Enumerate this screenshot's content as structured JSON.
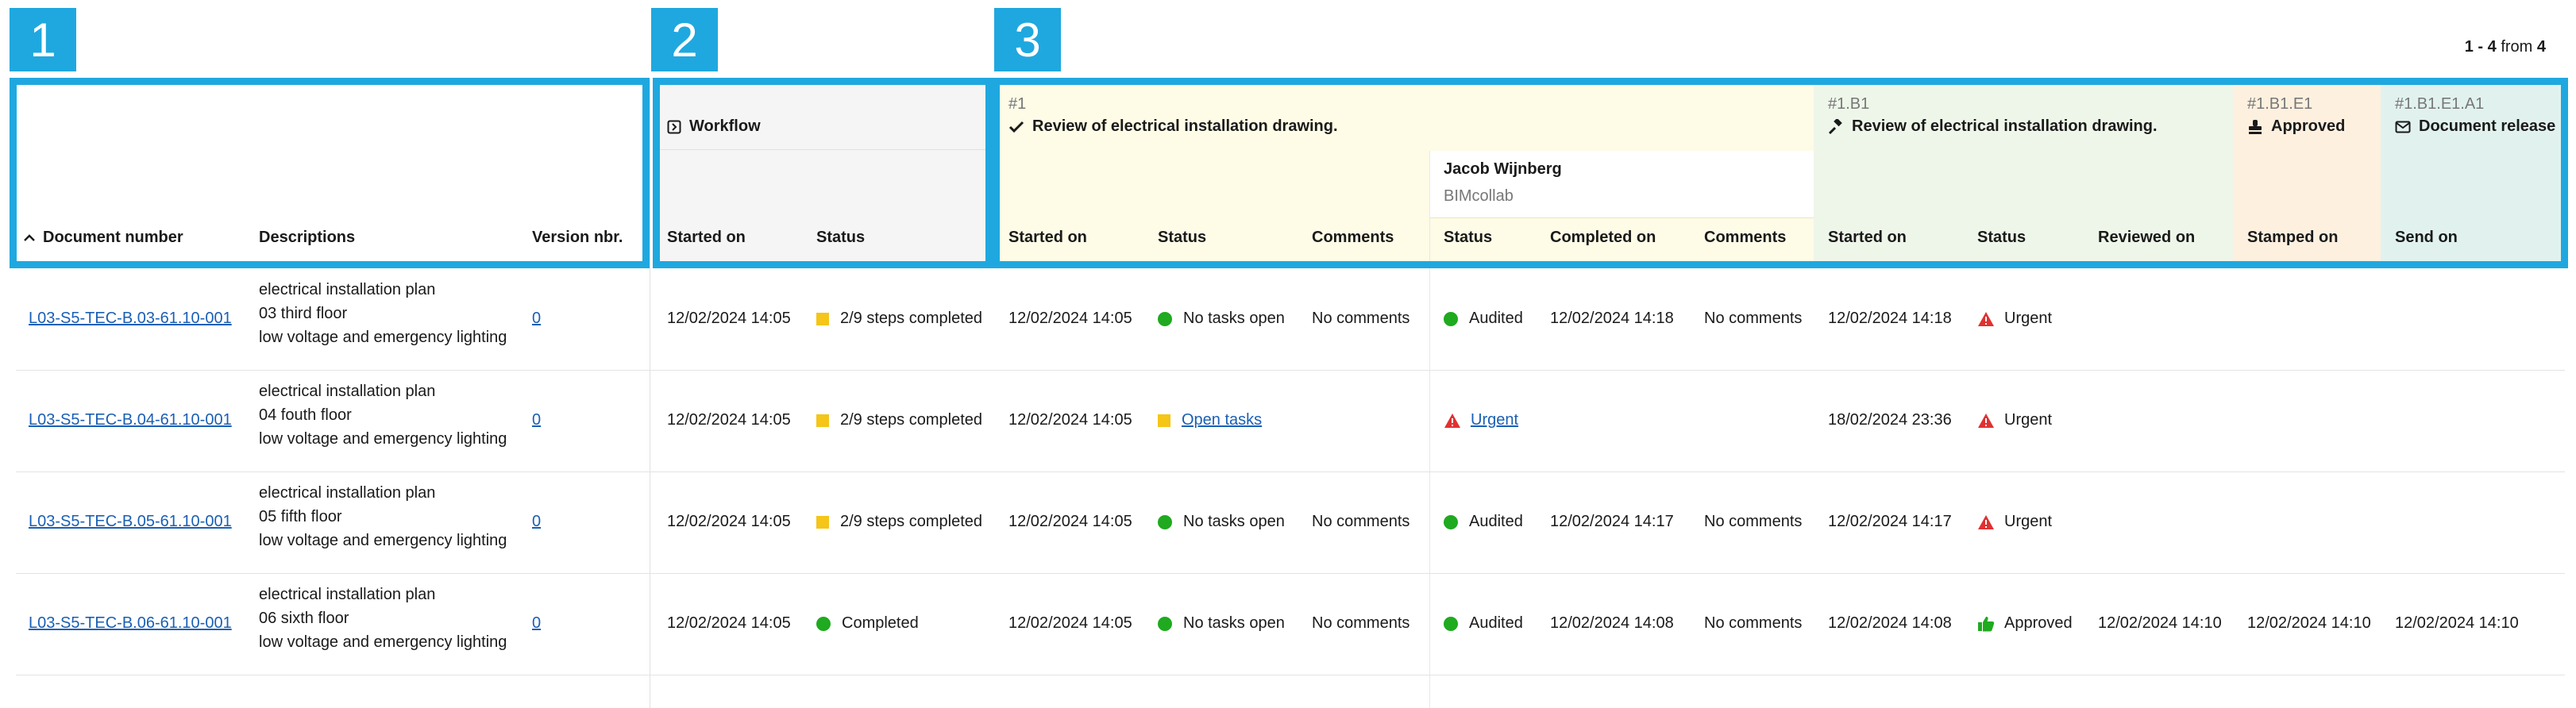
{
  "badges": [
    "1",
    "2",
    "3"
  ],
  "pager": {
    "range": "1 - 4",
    "from_word": "from",
    "total": "4"
  },
  "colors": {
    "accent": "#1fa8df",
    "workflow_bg": "#f5f5f5",
    "step1_bg": "#fefbe6",
    "stepB1_bg": "#eef6e9",
    "stepE1_bg": "#fef0df",
    "stepA1_bg": "#e1f2ee",
    "green": "#1faa1f",
    "yellow": "#f5c518",
    "red": "#e03131"
  },
  "headers": {
    "document_number": "Document number",
    "descriptions": "Descriptions",
    "version": "Version nbr.",
    "workflow": "Workflow",
    "wf_started": "Started on",
    "wf_status": "Status",
    "step1_code": "#1",
    "step1_title": "Review of electrical installation drawing.",
    "step1_started": "Started on",
    "step1_status": "Status",
    "step1_comments": "Comments",
    "reviewer_name": "Jacob Wijnberg",
    "reviewer_org": "BIMcollab",
    "rev_status": "Status",
    "rev_completed": "Completed on",
    "rev_comments": "Comments",
    "b1_code": "#1.B1",
    "b1_title": "Review of electrical installation drawing.",
    "b1_started": "Started on",
    "b1_status": "Status",
    "b1_reviewed": "Reviewed on",
    "e1_code": "#1.B1.E1",
    "e1_title": "Approved",
    "e1_stamped": "Stamped on",
    "a1_code": "#1.B1.E1.A1",
    "a1_title": "Document release",
    "a1_send": "Send on"
  },
  "rows": [
    {
      "doc": "L03-S5-TEC-B.03-61.10-001",
      "desc1": "electrical installation plan",
      "desc2": "03 third floor",
      "desc3": "low voltage and emergency lighting",
      "version": "0",
      "wf_started": "12/02/2024 14:05",
      "wf_status": "2/9 steps completed",
      "wf_icon": "yellow-square",
      "s1_started": "12/02/2024 14:05",
      "s1_status": "No tasks open",
      "s1_icon": "green-dot",
      "s1_comments": "No comments",
      "rev_status": "Audited",
      "rev_icon": "green-dot",
      "rev_completed": "12/02/2024 14:18",
      "rev_comments": "No comments",
      "b1_started": "12/02/2024 14:18",
      "b1_status": "Urgent",
      "b1_icon": "warning",
      "b1_reviewed": "",
      "e1_stamped": "",
      "a1_send": ""
    },
    {
      "doc": "L03-S5-TEC-B.04-61.10-001",
      "desc1": "electrical installation plan",
      "desc2": "04 fouth floor",
      "desc3": "low voltage and emergency lighting",
      "version": "0",
      "wf_started": "12/02/2024 14:05",
      "wf_status": "2/9 steps completed",
      "wf_icon": "yellow-square",
      "s1_started": "12/02/2024 14:05",
      "s1_status": "Open tasks",
      "s1_icon": "yellow-square",
      "s1_comments": "",
      "rev_status": "Urgent",
      "rev_icon": "warning",
      "rev_completed": "",
      "rev_comments": "",
      "b1_started": "18/02/2024 23:36",
      "b1_status": "Urgent",
      "b1_icon": "warning",
      "b1_reviewed": "",
      "e1_stamped": "",
      "a1_send": ""
    },
    {
      "doc": "L03-S5-TEC-B.05-61.10-001",
      "desc1": "electrical installation plan",
      "desc2": "05 fifth floor",
      "desc3": "low voltage and emergency lighting",
      "version": "0",
      "wf_started": "12/02/2024 14:05",
      "wf_status": "2/9 steps completed",
      "wf_icon": "yellow-square",
      "s1_started": "12/02/2024 14:05",
      "s1_status": "No tasks open",
      "s1_icon": "green-dot",
      "s1_comments": "No comments",
      "rev_status": "Audited",
      "rev_icon": "green-dot",
      "rev_completed": "12/02/2024 14:17",
      "rev_comments": "No comments",
      "b1_started": "12/02/2024 14:17",
      "b1_status": "Urgent",
      "b1_icon": "warning",
      "b1_reviewed": "",
      "e1_stamped": "",
      "a1_send": ""
    },
    {
      "doc": "L03-S5-TEC-B.06-61.10-001",
      "desc1": "electrical installation plan",
      "desc2": "06 sixth floor",
      "desc3": "low voltage and emergency lighting",
      "version": "0",
      "wf_started": "12/02/2024 14:05",
      "wf_status": "Completed",
      "wf_icon": "green-dot",
      "s1_started": "12/02/2024 14:05",
      "s1_status": "No tasks open",
      "s1_icon": "green-dot",
      "s1_comments": "No comments",
      "rev_status": "Audited",
      "rev_icon": "green-dot",
      "rev_completed": "12/02/2024 14:08",
      "rev_comments": "No comments",
      "b1_started": "12/02/2024 14:08",
      "b1_status": "Approved",
      "b1_icon": "thumbs-up",
      "b1_reviewed": "12/02/2024 14:10",
      "e1_stamped": "12/02/2024 14:10",
      "a1_send": "12/02/2024 14:10"
    }
  ]
}
